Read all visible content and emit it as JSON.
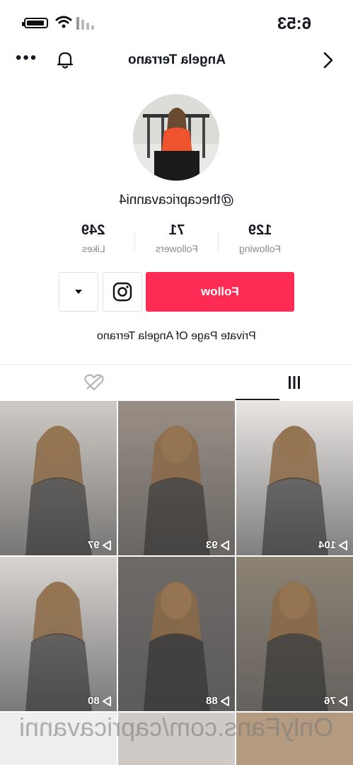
{
  "status_bar": {
    "time": "6:53"
  },
  "header": {
    "title": "Angela Terrano"
  },
  "profile": {
    "handle": "@thecapricavanni4",
    "stats": [
      {
        "value": "129",
        "label": "Following"
      },
      {
        "value": "71",
        "label": "Followers"
      },
      {
        "value": "249",
        "label": "Likes"
      }
    ],
    "follow_label": "Follow",
    "bio": "Private Page Of Angela Terrano"
  },
  "colors": {
    "accent": "#fe2c55",
    "text": "#161823",
    "muted": "#8a8b91"
  },
  "icons": [
    "more-icon",
    "bell-icon",
    "back-chevron-icon",
    "instagram-icon",
    "dropdown-caret-icon",
    "grid-icon",
    "liked-heart-icon",
    "play-icon"
  ],
  "videos": [
    {
      "views": "104",
      "bg": "#e9e6e4"
    },
    {
      "views": "93",
      "bg": "#9a8f86"
    },
    {
      "views": "97",
      "bg": "#cfcac5"
    },
    {
      "views": "76",
      "bg": "#8c8274"
    },
    {
      "views": "88",
      "bg": "#6e6a68"
    },
    {
      "views": "80",
      "bg": "#d8d4d2"
    }
  ],
  "watermark": "OnlyFans.com/capricavanni"
}
